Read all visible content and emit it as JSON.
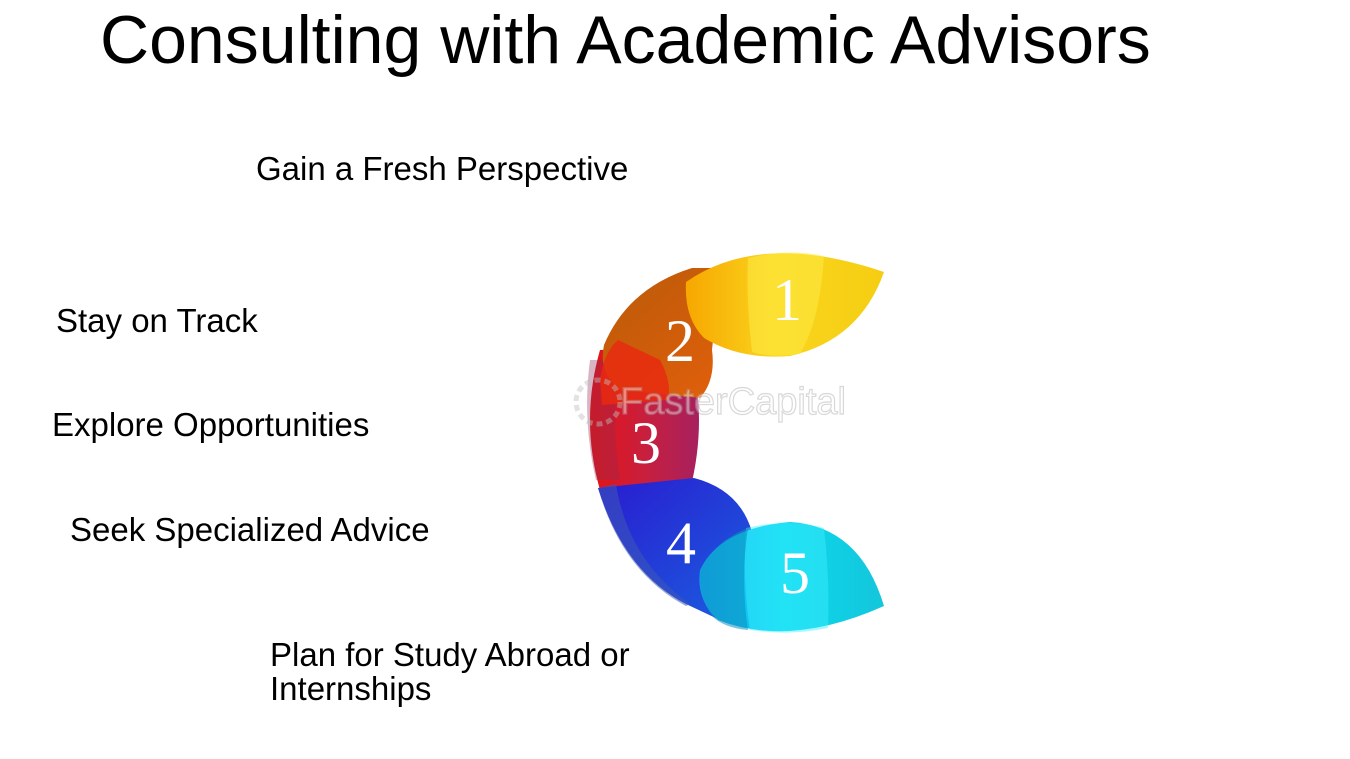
{
  "title": "Consulting with Academic Advisors",
  "steps": [
    {
      "number": "1",
      "label": "Gain a Fresh Perspective",
      "color": "#F9D21A"
    },
    {
      "number": "2",
      "label": "Stay on Track",
      "color": "#E4670F"
    },
    {
      "number": "3",
      "label": "Explore Opportunities",
      "color": "#C21F4A"
    },
    {
      "number": "4",
      "label": "Seek Specialized Advice",
      "color": "#1D4FD8"
    },
    {
      "number": "5",
      "label": "Plan for Study Abroad or Internships",
      "color": "#14CFE6"
    }
  ],
  "watermark": "FasterCapital",
  "icons": {
    "watermark_mark": "gear-icon"
  }
}
